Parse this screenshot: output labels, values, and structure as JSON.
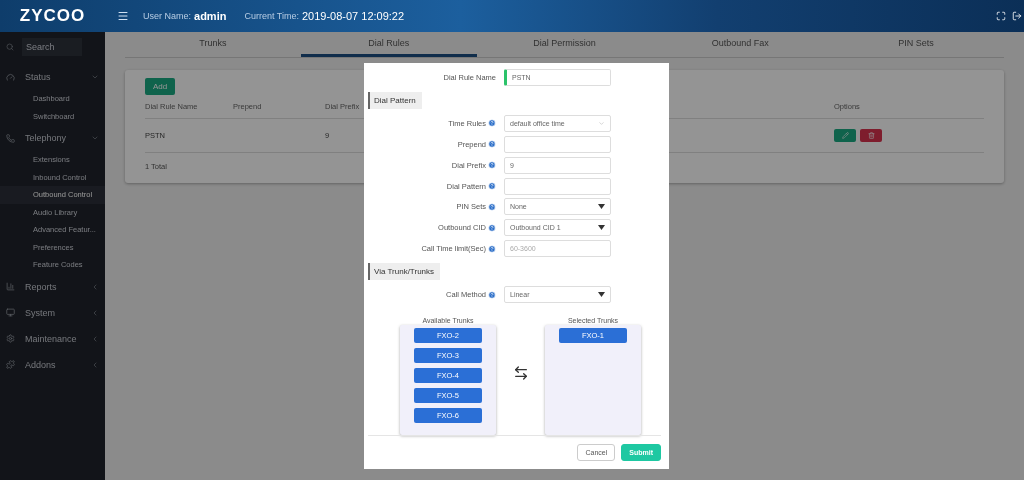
{
  "header": {
    "logo": "ZYCOO",
    "user_label": "User Name:",
    "user_name": "admin",
    "time_label": "Current Time:",
    "time": "2019-08-07 12:09:22"
  },
  "sidebar": {
    "search": {
      "placeholder": "Search"
    },
    "items": [
      {
        "label": "Status",
        "expanded": true,
        "children": [
          {
            "label": "Dashboard",
            "selected": false
          },
          {
            "label": "Switchboard",
            "selected": false
          }
        ]
      },
      {
        "label": "Telephony",
        "expanded": true,
        "children": [
          {
            "label": "Extensions",
            "selected": false
          },
          {
            "label": "Inbound Control",
            "selected": false
          },
          {
            "label": "Outbound Control",
            "selected": true
          },
          {
            "label": "Audio Library",
            "selected": false
          },
          {
            "label": "Advanced Featur...",
            "selected": false
          },
          {
            "label": "Preferences",
            "selected": false
          },
          {
            "label": "Feature Codes",
            "selected": false
          }
        ]
      },
      {
        "label": "Reports",
        "expanded": false
      },
      {
        "label": "System",
        "expanded": false
      },
      {
        "label": "Maintenance",
        "expanded": false
      },
      {
        "label": "Addons",
        "expanded": false
      }
    ]
  },
  "tabs": [
    {
      "label": "Trunks",
      "selected": false
    },
    {
      "label": "Dial Rules",
      "selected": true
    },
    {
      "label": "Dial Permission",
      "selected": false
    },
    {
      "label": "Outbound Fax",
      "selected": false
    },
    {
      "label": "PIN Sets",
      "selected": false
    }
  ],
  "table": {
    "add_button": "Add",
    "columns": [
      "Dial Rule Name",
      "Prepend",
      "Dial Prefix",
      "Options"
    ],
    "rows": [
      {
        "cells": [
          "PSTN",
          null,
          "9"
        ]
      }
    ],
    "total": "1 Total"
  },
  "dialog": {
    "top_field": {
      "label": "Dial Rule Name",
      "value": "PSTN",
      "required": true
    },
    "sections": [
      {
        "title": "Dial Pattern",
        "fields": [
          {
            "kind": "chevron-select",
            "label": "Time Rules",
            "help": true,
            "value": "default office time"
          },
          {
            "kind": "text",
            "label": "Prepend",
            "help": true
          },
          {
            "kind": "text",
            "label": "Dial Prefix",
            "help": true,
            "value": "9"
          },
          {
            "kind": "text",
            "label": "Dial Pattern",
            "help": true
          },
          {
            "kind": "select",
            "label": "PIN Sets",
            "help": true,
            "value": "None"
          },
          {
            "kind": "select",
            "label": "Outbound CID",
            "help": true,
            "value": "Outbound CID 1"
          },
          {
            "kind": "text",
            "label": "Call Time limit(Sec)",
            "help": true,
            "placeholder": "60-3600"
          }
        ]
      },
      {
        "title": "Via Trunk/Trunks",
        "fields": [
          {
            "kind": "select",
            "label": "Call Method",
            "help": true,
            "value": "Linear"
          }
        ]
      }
    ],
    "available": {
      "title": "Available Trunks",
      "items": [
        "FXO-2",
        "FXO-3",
        "FXO-4",
        "FXO-5",
        "FXO-6"
      ]
    },
    "selected": {
      "title": "Selected Trunks",
      "items": [
        "FXO-1"
      ]
    },
    "buttons": [
      {
        "label": "Cancel",
        "kind": "secondary"
      },
      {
        "label": "Submit",
        "kind": "primary"
      }
    ]
  }
}
